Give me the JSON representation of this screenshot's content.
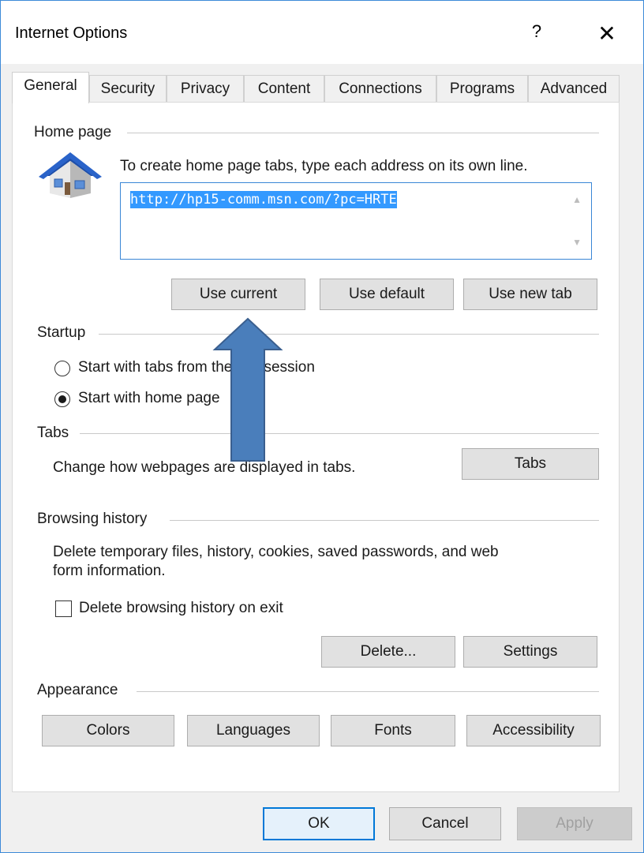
{
  "window": {
    "title": "Internet Options",
    "help_label": "?",
    "close_label": "✕"
  },
  "tabs": [
    {
      "label": "General",
      "active": true
    },
    {
      "label": "Security"
    },
    {
      "label": "Privacy"
    },
    {
      "label": "Content"
    },
    {
      "label": "Connections"
    },
    {
      "label": "Programs"
    },
    {
      "label": "Advanced"
    }
  ],
  "home_page": {
    "title": "Home page",
    "description": "To create home page tabs, type each address on its own line.",
    "url": "http://hp15-comm.msn.com/?pc=HRTE",
    "buttons": {
      "use_current": "Use current",
      "use_default": "Use default",
      "use_new_tab": "Use new tab"
    }
  },
  "startup": {
    "title": "Startup",
    "option_last_session": "Start with tabs from the last session",
    "option_home_page": "Start with home page",
    "selected": "home_page"
  },
  "tabs_group": {
    "title": "Tabs",
    "description": "Change how webpages are displayed in tabs.",
    "button": "Tabs"
  },
  "browsing_history": {
    "title": "Browsing history",
    "description_line1": "Delete temporary files, history, cookies, saved passwords, and web",
    "description_line2": "form information.",
    "delete_on_exit_label": "Delete browsing history on exit",
    "delete_on_exit_checked": false,
    "delete_button": "Delete...",
    "settings_button": "Settings"
  },
  "appearance": {
    "title": "Appearance",
    "colors": "Colors",
    "languages": "Languages",
    "fonts": "Fonts",
    "accessibility": "Accessibility"
  },
  "footer": {
    "ok": "OK",
    "cancel": "Cancel",
    "apply": "Apply"
  },
  "colors": {
    "accent": "#0078d7",
    "selection": "#3399ff",
    "arrow_fill": "#4a7ebb",
    "arrow_stroke": "#3a5f8f"
  }
}
